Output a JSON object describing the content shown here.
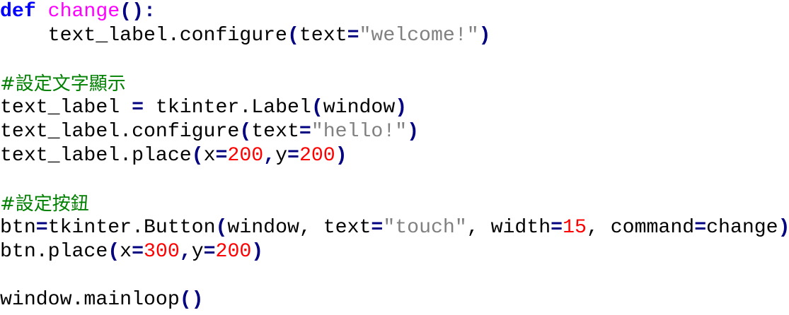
{
  "editor": {
    "lines": [
      [
        {
          "t": "def",
          "c": "kw"
        },
        {
          "t": " "
        },
        {
          "t": "change",
          "c": "fn"
        },
        {
          "t": "():",
          "c": "op"
        }
      ],
      [
        {
          "t": "    text_label.configure"
        },
        {
          "t": "(",
          "c": "op"
        },
        {
          "t": "text"
        },
        {
          "t": "=",
          "c": "op"
        },
        {
          "t": "\"welcome!\"",
          "c": "str"
        },
        {
          "t": ")",
          "c": "op"
        }
      ],
      [],
      [
        {
          "t": "#設定文字顯示",
          "c": "cmt"
        }
      ],
      [
        {
          "t": "text_label "
        },
        {
          "t": "=",
          "c": "op"
        },
        {
          "t": " tkinter.Label"
        },
        {
          "t": "(",
          "c": "op"
        },
        {
          "t": "window"
        },
        {
          "t": ")",
          "c": "op"
        }
      ],
      [
        {
          "t": "text_label.configure"
        },
        {
          "t": "(",
          "c": "op"
        },
        {
          "t": "text"
        },
        {
          "t": "=",
          "c": "op"
        },
        {
          "t": "\"hello!\"",
          "c": "str"
        },
        {
          "t": ")",
          "c": "op"
        }
      ],
      [
        {
          "t": "text_label.place"
        },
        {
          "t": "(",
          "c": "op"
        },
        {
          "t": "x"
        },
        {
          "t": "=",
          "c": "op"
        },
        {
          "t": "200",
          "c": "num"
        },
        {
          "t": ",",
          "c": "op"
        },
        {
          "t": "y"
        },
        {
          "t": "=",
          "c": "op"
        },
        {
          "t": "200",
          "c": "num"
        },
        {
          "t": ")",
          "c": "op"
        }
      ],
      [],
      [
        {
          "t": "#設定按鈕",
          "c": "cmt"
        }
      ],
      [
        {
          "t": "btn"
        },
        {
          "t": "=",
          "c": "op"
        },
        {
          "t": "tkinter.Button"
        },
        {
          "t": "(",
          "c": "op"
        },
        {
          "t": "window, text"
        },
        {
          "t": "=",
          "c": "op"
        },
        {
          "t": "\"touch\"",
          "c": "str"
        },
        {
          "t": ", width"
        },
        {
          "t": "=",
          "c": "op"
        },
        {
          "t": "15",
          "c": "num"
        },
        {
          "t": ", command"
        },
        {
          "t": "=",
          "c": "op"
        },
        {
          "t": "change"
        },
        {
          "t": ")",
          "c": "op"
        }
      ],
      [
        {
          "t": "btn.place"
        },
        {
          "t": "(",
          "c": "op"
        },
        {
          "t": "x"
        },
        {
          "t": "=",
          "c": "op"
        },
        {
          "t": "300",
          "c": "num"
        },
        {
          "t": ",",
          "c": "op"
        },
        {
          "t": "y"
        },
        {
          "t": "=",
          "c": "op"
        },
        {
          "t": "200",
          "c": "num"
        },
        {
          "t": ")",
          "c": "op"
        }
      ],
      [],
      [
        {
          "t": "window.mainloop"
        },
        {
          "t": "()",
          "c": "op"
        }
      ]
    ]
  }
}
